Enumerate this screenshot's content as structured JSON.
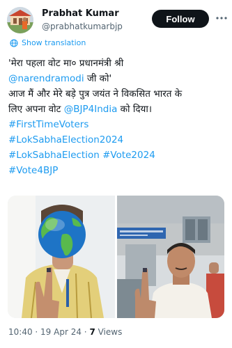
{
  "author": {
    "name": "Prabhat Kumar",
    "handle": "@prabhatkumarbjp",
    "follow_label": "Follow"
  },
  "translate_label": "Show translation",
  "tweet": {
    "line1": "'मेरा पहला वोट मा० प्रधानमंत्री श्री",
    "line2_mention": "@narendramodi",
    "line2_rest": " जी को'",
    "line3": "आज मैं और मेरे बड़े पुत्र जयंत ने विकसित भारत के",
    "line4_pre": "लिए अपना वोट ",
    "line4_mention": "@BJP4India",
    "line4_post": " को दिया।",
    "hashtag1": "#FirstTimeVoters",
    "hashtag2": "#LokSabhaElection2024",
    "hashtag3a": "#LokSabhaElection",
    "hashtag3b": "#Vote2024",
    "hashtag4": "#Vote4BJP"
  },
  "meta": {
    "time": "10:40",
    "sep1": " · ",
    "date": "19 Apr 24",
    "sep2": " · ",
    "views_count": "7",
    "views_label": " Views"
  },
  "colors": {
    "link": "#1d9bf0",
    "text": "#0f1419",
    "muted": "#536471"
  },
  "icons": {
    "translate": "globe-icon",
    "more": "more-icon"
  }
}
